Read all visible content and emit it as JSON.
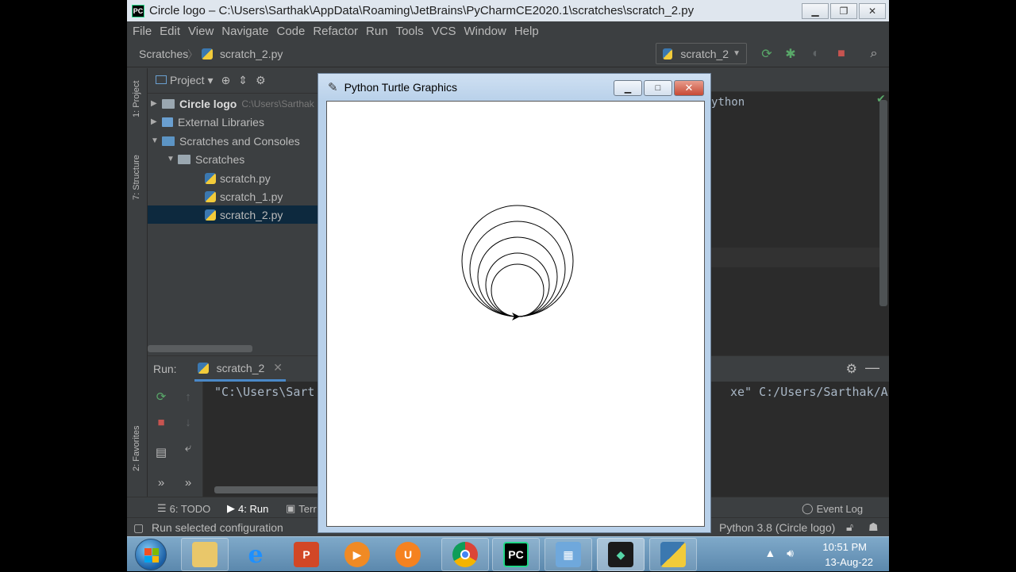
{
  "window": {
    "title": "Circle logo – C:\\Users\\Sarthak\\AppData\\Roaming\\JetBrains\\PyCharmCE2020.1\\scratches\\scratch_2.py",
    "app_icon_label": "PC"
  },
  "menu": [
    "File",
    "Edit",
    "View",
    "Navigate",
    "Code",
    "Refactor",
    "Run",
    "Tools",
    "VCS",
    "Window",
    "Help"
  ],
  "navbar": {
    "crumb1": "Scratches",
    "crumb2": "scratch_2.py",
    "run_config": "scratch_2"
  },
  "left_stripe": {
    "project_label": "1: Project",
    "structure_label": "7: Structure",
    "favorites_label": "2: Favorites"
  },
  "project": {
    "header": "Project",
    "tree": [
      {
        "label": "Circle logo",
        "sub": "C:\\Users\\Sarthak"
      },
      {
        "label": "External Libraries"
      },
      {
        "label": "Scratches and Consoles"
      },
      {
        "label": "Scratches"
      },
      {
        "label": "scratch.py"
      },
      {
        "label": "scratch_1.py"
      },
      {
        "label": "scratch_2.py"
      }
    ]
  },
  "editor": {
    "code_fragment": "ython"
  },
  "run": {
    "label": "Run:",
    "tab": "scratch_2",
    "console_left": "\"C:\\Users\\Sart",
    "console_right": "xe\" C:/Users/Sarthak/App"
  },
  "bottombar": {
    "todo": "6: TODO",
    "run": "4: Run",
    "terminal": "Terr",
    "event_log": "Event Log"
  },
  "status": {
    "text": "Run selected configuration",
    "interpreter": "Python 3.8 (Circle logo)"
  },
  "turtle": {
    "title": "Python Turtle Graphics"
  },
  "taskbar": {
    "time": "10:51 PM",
    "date": "13-Aug-22",
    "apps": [
      "windows-explorer",
      "internet-explorer",
      "powerpoint",
      "media-player",
      "uc-browser",
      "chrome",
      "pycharm",
      "control-panel",
      "filmora",
      "python"
    ]
  },
  "colors": {
    "ide_bg": "#3c3f41",
    "editor_bg": "#2b2b2b",
    "selection": "#0d293e",
    "accent_blue": "#4a88c7",
    "run_green": "#59a869",
    "stop_red": "#c75450"
  }
}
